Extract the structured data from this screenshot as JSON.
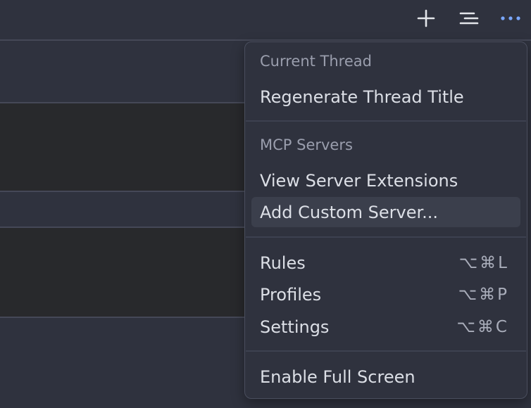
{
  "toolbar": {
    "new_thread_icon": "plus-icon",
    "history_icon": "list-icon",
    "more_icon": "ellipsis-icon"
  },
  "menu": {
    "current_thread_label": "Current Thread",
    "regenerate_title": "Regenerate Thread Title",
    "mcp_servers_label": "MCP Servers",
    "view_server_extensions": "View Server Extensions",
    "add_custom_server": "Add Custom Server...",
    "rules": {
      "label": "Rules",
      "shortcut": "⌥⌘L"
    },
    "profiles": {
      "label": "Profiles",
      "shortcut": "⌥⌘P"
    },
    "settings": {
      "label": "Settings",
      "shortcut": "⌥⌘C"
    },
    "enable_full_screen": "Enable Full Screen"
  },
  "colors": {
    "background": "#2f323e",
    "panel": "#28292c",
    "highlight": "#3b3f4c",
    "accent": "#7aa7ff"
  }
}
